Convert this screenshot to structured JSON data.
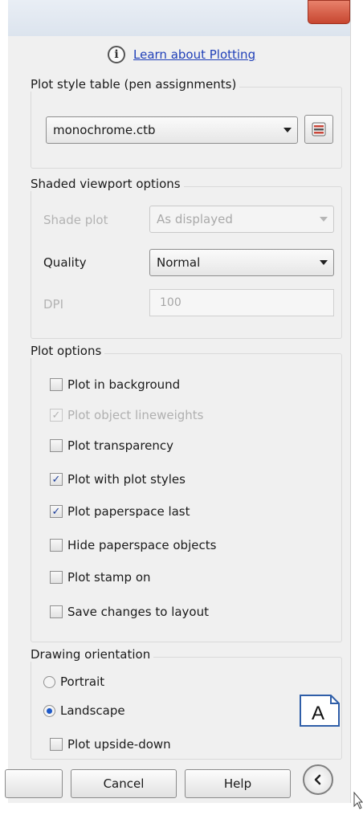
{
  "info": {
    "icon": "info-icon",
    "link_text": "Learn about Plotting"
  },
  "plot_style_table": {
    "section_label": "Plot style table (pen assignments)",
    "selected": "monochrome.ctb",
    "edit_icon": "edit-plot-style-icon"
  },
  "shaded_viewport": {
    "section_label": "Shaded viewport options",
    "shade_plot_label": "Shade plot",
    "shade_plot_value": "As displayed",
    "quality_label": "Quality",
    "quality_value": "Normal",
    "dpi_label": "DPI",
    "dpi_value": "100"
  },
  "plot_options": {
    "section_label": "Plot options",
    "items": [
      {
        "label": "Plot in background",
        "checked": false,
        "enabled": true
      },
      {
        "label": "Plot object lineweights",
        "checked": true,
        "enabled": false
      },
      {
        "label": "Plot transparency",
        "checked": false,
        "enabled": true
      },
      {
        "label": "Plot with plot styles",
        "checked": true,
        "enabled": true
      },
      {
        "label": "Plot paperspace last",
        "checked": true,
        "enabled": true
      },
      {
        "label": "Hide paperspace objects",
        "checked": false,
        "enabled": true
      },
      {
        "label": "Plot stamp on",
        "checked": false,
        "enabled": true
      },
      {
        "label": "Save changes to layout",
        "checked": false,
        "enabled": true
      }
    ]
  },
  "drawing_orientation": {
    "section_label": "Drawing orientation",
    "portrait_label": "Portrait",
    "landscape_label": "Landscape",
    "selected": "Landscape",
    "upside_down_label": "Plot upside-down",
    "upside_down_checked": false,
    "preview_letter": "A"
  },
  "buttons": {
    "ok_label": "",
    "cancel_label": "Cancel",
    "help_label": "Help",
    "collapse_icon": "chevron-left-icon"
  },
  "colors": {
    "dialog_bg": "#f0f0f0",
    "link": "#1f3fb8",
    "check": "#1d3e9b",
    "close_button": "#c74630"
  }
}
